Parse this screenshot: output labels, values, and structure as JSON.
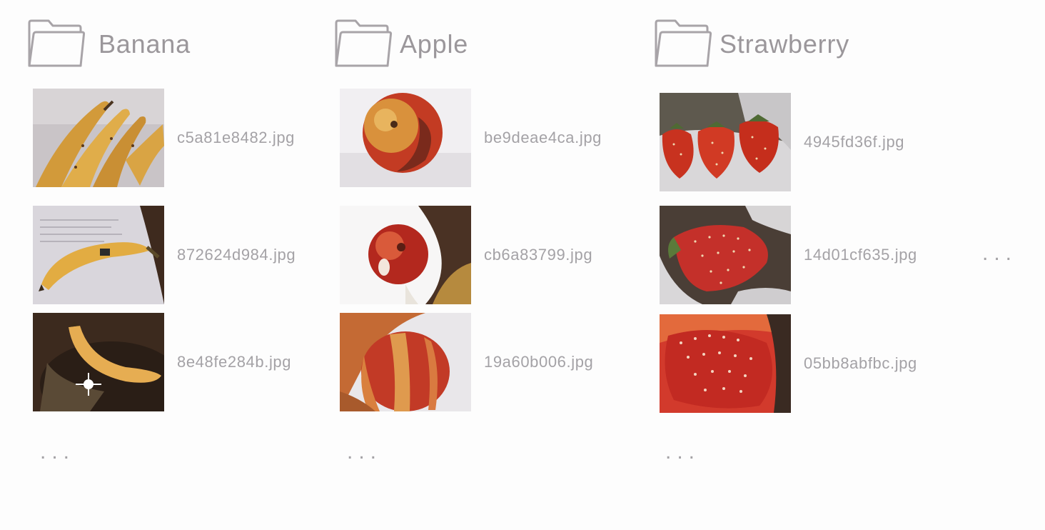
{
  "folders": [
    {
      "name": "Banana",
      "files": [
        "c5a81e8482.jpg",
        "872624d984.jpg",
        "8e48fe284b.jpg"
      ],
      "more": "..."
    },
    {
      "name": "Apple",
      "files": [
        "be9deae4ca.jpg",
        "cb6a83799.jpg",
        "19a60b006.jpg"
      ],
      "more": "..."
    },
    {
      "name": "Strawberry",
      "files": [
        "4945fd36f.jpg",
        "14d01cf635.jpg",
        "05bb8abfbc.jpg"
      ],
      "more": "..."
    }
  ],
  "more_folders": "...",
  "colors": {
    "background": "#fdfdfd",
    "text": "#a4a2a6",
    "folder_outline": "#9b979b"
  }
}
